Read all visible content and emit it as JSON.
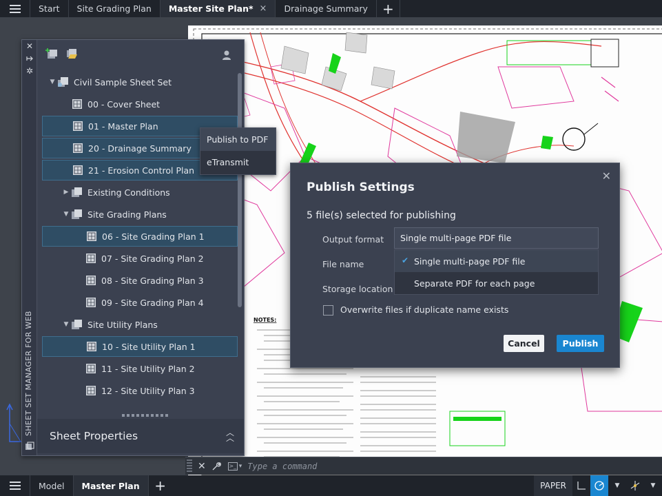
{
  "top_tabs": [
    {
      "label": "Start",
      "active": false
    },
    {
      "label": "Site Grading Plan",
      "active": false
    },
    {
      "label": "Master Site Plan*",
      "active": true,
      "close": "×"
    },
    {
      "label": "Drainage Summary",
      "active": false
    }
  ],
  "palette": {
    "vertical_title": "SHEET SET MANAGER FOR WEB",
    "tree": [
      {
        "label": "Civil Sample Sheet Set",
        "kind": "set",
        "level": 0,
        "toggle": "expanded"
      },
      {
        "label": "00 - Cover Sheet",
        "kind": "sheet",
        "level": 1,
        "selected": false
      },
      {
        "label": "01 - Master Plan",
        "kind": "sheet",
        "level": 1,
        "selected": true
      },
      {
        "label": "20 - Drainage Summary",
        "kind": "sheet",
        "level": 1,
        "selected": true
      },
      {
        "label": "21 - Erosion Control Plan",
        "kind": "sheet",
        "level": 1,
        "selected": true
      },
      {
        "label": "Existing Conditions",
        "kind": "subset",
        "level": 1,
        "toggle": "collapsed"
      },
      {
        "label": "Site Grading Plans",
        "kind": "subset",
        "level": 1,
        "toggle": "expanded"
      },
      {
        "label": "06 - Site Grading Plan 1",
        "kind": "sheet",
        "level": 2,
        "selected": true
      },
      {
        "label": "07 - Site Grading Plan 2",
        "kind": "sheet",
        "level": 2,
        "selected": false
      },
      {
        "label": "08 - Site Grading Plan 3",
        "kind": "sheet",
        "level": 2,
        "selected": false
      },
      {
        "label": "09 - Site Grading Plan 4",
        "kind": "sheet",
        "level": 2,
        "selected": false
      },
      {
        "label": "Site Utility Plans",
        "kind": "subset",
        "level": 1,
        "toggle": "expanded"
      },
      {
        "label": "10 - Site Utility Plan 1",
        "kind": "sheet",
        "level": 2,
        "selected": true
      },
      {
        "label": "11 - Site Utility Plan 2",
        "kind": "sheet",
        "level": 2,
        "selected": false
      },
      {
        "label": "12 - Site Utility Plan 3",
        "kind": "sheet",
        "level": 2,
        "selected": false
      }
    ],
    "properties_title": "Sheet Properties"
  },
  "context_menu": {
    "items": [
      "Publish to PDF",
      "eTransmit"
    ]
  },
  "dialog": {
    "title": "Publish Settings",
    "subtitle": "5 file(s) selected for publishing",
    "output_format_label": "Output format",
    "file_name_label": "File name",
    "storage_location_label": "Storage location",
    "output_format_value": "Single multi-page PDF file",
    "options": [
      "Single multi-page PDF file",
      "Separate PDF for each page"
    ],
    "overwrite_label": "Overwrite files if duplicate name exists",
    "cancel_label": "Cancel",
    "publish_label": "Publish"
  },
  "command_line": {
    "placeholder": "Type a command"
  },
  "bottom_tabs": [
    {
      "label": "Model",
      "active": false
    },
    {
      "label": "Master Plan",
      "active": true
    }
  ],
  "status": {
    "paper_label": "PAPER"
  },
  "drawing": {
    "notes_heading": "NOTES:"
  },
  "colors": {
    "accent": "#1a86d0",
    "selection": "#2f4d64",
    "panel": "#3b4150",
    "drawing_magenta": "#e0389c",
    "drawing_red": "#e0332f",
    "drawing_green": "#17d31a"
  }
}
